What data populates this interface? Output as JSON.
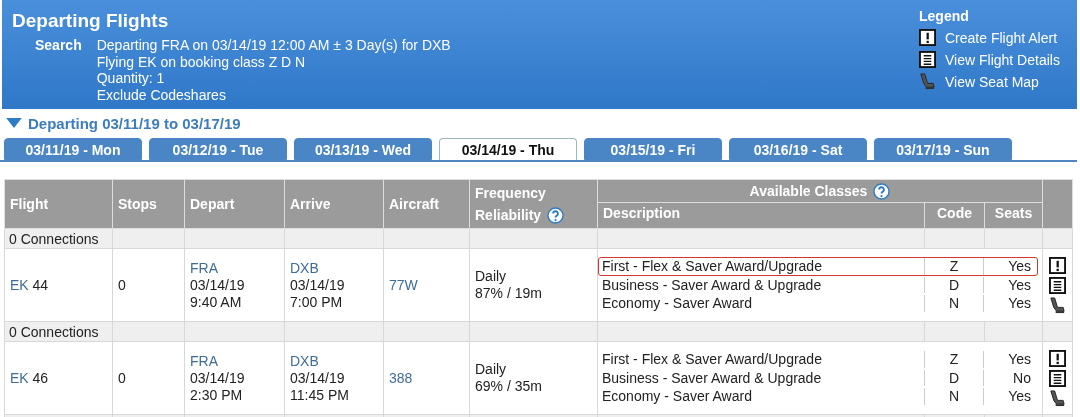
{
  "header": {
    "title": "Departing Flights",
    "search_label": "Search",
    "search_lines": [
      "Departing FRA on 03/14/19 12:00 AM ± 3 Day(s) for DXB",
      "Flying EK on booking class Z D N",
      "Quantity: 1",
      "Exclude Codeshares"
    ],
    "legend": {
      "title": "Legend",
      "items": [
        {
          "kind": "alert",
          "label": "Create Flight Alert"
        },
        {
          "kind": "details",
          "label": "View Flight Details"
        },
        {
          "kind": "seat",
          "label": "View Seat Map"
        }
      ]
    }
  },
  "range": {
    "label": "Departing 03/11/19 to 03/17/19",
    "expanded": true
  },
  "tabs": [
    {
      "label": "03/11/19 - Mon",
      "selected": false
    },
    {
      "label": "03/12/19 - Tue",
      "selected": false
    },
    {
      "label": "03/13/19 - Wed",
      "selected": false
    },
    {
      "label": "03/14/19 - Thu",
      "selected": true
    },
    {
      "label": "03/15/19 - Fri",
      "selected": false
    },
    {
      "label": "03/16/19 - Sat",
      "selected": false
    },
    {
      "label": "03/17/19 - Sun",
      "selected": false
    }
  ],
  "table": {
    "columns": [
      "Flight",
      "Stops",
      "Depart",
      "Arrive",
      "Aircraft"
    ],
    "frequency_header": "Frequency",
    "reliability_header": "Reliability",
    "classes_header": "Available Classes",
    "class_columns": [
      "Description",
      "Code",
      "Seats"
    ],
    "groups": [
      {
        "connections": "0 Connections",
        "airline": "EK",
        "number": "44",
        "stops": "0",
        "depart": {
          "airport": "FRA",
          "date": "03/14/19",
          "time": "9:40 AM"
        },
        "arrive": {
          "airport": "DXB",
          "date": "03/14/19",
          "time": "7:00 PM"
        },
        "aircraft": "77W",
        "frequency": "Daily",
        "reliability": "87% / 19m",
        "classes": [
          {
            "description": "First - Flex & Saver Award/Upgrade",
            "code": "Z",
            "seats": "Yes",
            "highlighted": true
          },
          {
            "description": "Business - Saver Award & Upgrade",
            "code": "D",
            "seats": "Yes",
            "highlighted": false
          },
          {
            "description": "Economy - Saver Award",
            "code": "N",
            "seats": "Yes",
            "highlighted": false
          }
        ]
      },
      {
        "connections": "0 Connections",
        "airline": "EK",
        "number": "46",
        "stops": "0",
        "depart": {
          "airport": "FRA",
          "date": "03/14/19",
          "time": "2:30 PM"
        },
        "arrive": {
          "airport": "DXB",
          "date": "03/14/19",
          "time": "11:45 PM"
        },
        "aircraft": "388",
        "frequency": "Daily",
        "reliability": "69% / 35m",
        "classes": [
          {
            "description": "First - Flex & Saver Award/Upgrade",
            "code": "Z",
            "seats": "Yes",
            "highlighted": false
          },
          {
            "description": "Business - Saver Award & Upgrade",
            "code": "D",
            "seats": "No",
            "highlighted": false
          },
          {
            "description": "Economy - Saver Award",
            "code": "N",
            "seats": "Yes",
            "highlighted": false
          }
        ]
      }
    ]
  }
}
